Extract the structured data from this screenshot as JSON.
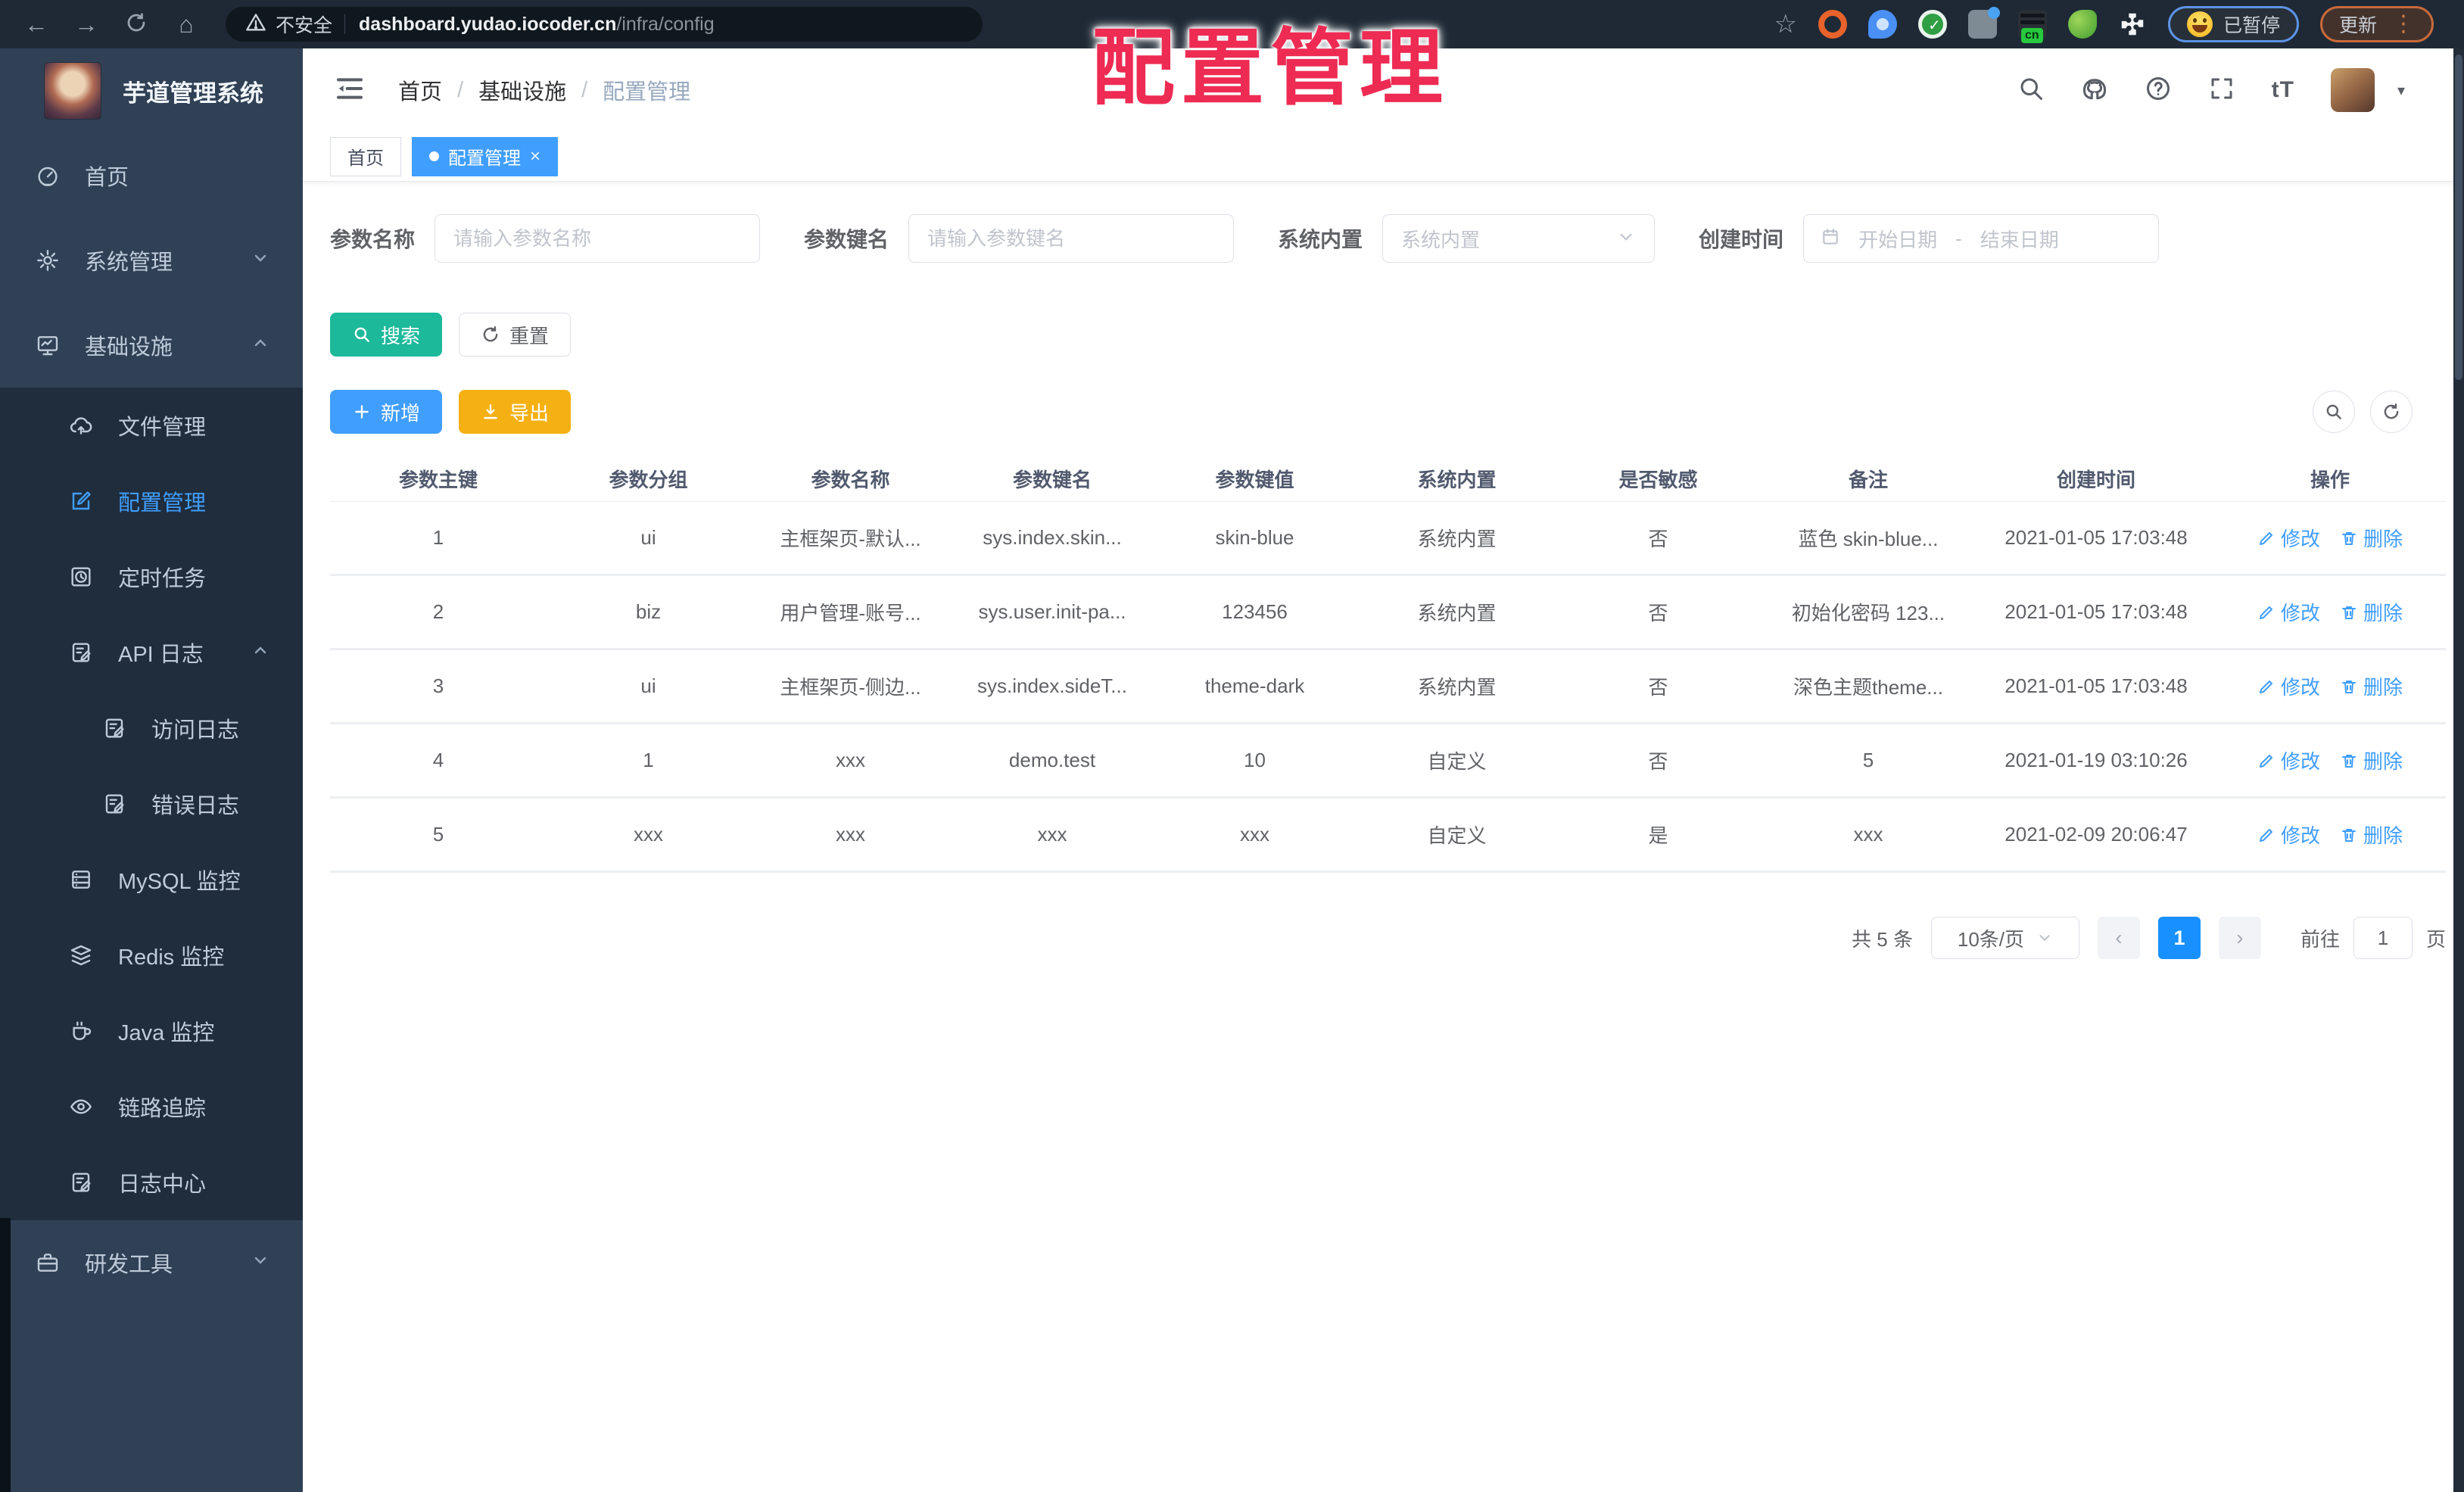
{
  "browser": {
    "security_label": "不安全",
    "url_host": "dashboard.yudao.iocoder.cn",
    "url_path": "/infra/config",
    "paused_label": "已暂停",
    "update_label": "更新",
    "ext_cn_label": "cn",
    "dots_menu": "⋮",
    "back": "←",
    "forward": "→",
    "home": "⌂",
    "star": "☆",
    "caret": "▾"
  },
  "overlay": {
    "title": "配置管理"
  },
  "sidebar": {
    "brand": "芋道管理系统",
    "items": [
      {
        "label": "首页"
      },
      {
        "label": "系统管理"
      },
      {
        "label": "基础设施"
      },
      {
        "label": "文件管理"
      },
      {
        "label": "配置管理"
      },
      {
        "label": "定时任务"
      },
      {
        "label": "API 日志"
      },
      {
        "label": "访问日志"
      },
      {
        "label": "错误日志"
      },
      {
        "label": "MySQL 监控"
      },
      {
        "label": "Redis 监控"
      },
      {
        "label": "Java 监控"
      },
      {
        "label": "链路追踪"
      },
      {
        "label": "日志中心"
      },
      {
        "label": "研发工具"
      }
    ]
  },
  "header": {
    "breadcrumb": [
      "首页",
      "基础设施",
      "配置管理"
    ],
    "separator": "/",
    "font_icon_label": "tT"
  },
  "tabs": [
    {
      "label": "首页"
    },
    {
      "label": "配置管理",
      "close": "×"
    }
  ],
  "filters": {
    "name_label": "参数名称",
    "name_placeholder": "请输入参数名称",
    "key_label": "参数键名",
    "key_placeholder": "请输入参数键名",
    "type_label": "系统内置",
    "type_placeholder": "系统内置",
    "date_label": "创建时间",
    "date_start_placeholder": "开始日期",
    "date_separator": "-",
    "date_end_placeholder": "结束日期",
    "search_label": "搜索",
    "reset_label": "重置"
  },
  "toolbar": {
    "add_label": "新增",
    "export_label": "导出"
  },
  "table": {
    "columns": [
      "参数主键",
      "参数分组",
      "参数名称",
      "参数键名",
      "参数键值",
      "系统内置",
      "是否敏感",
      "备注",
      "创建时间",
      "操作"
    ],
    "edit_label": "修改",
    "delete_label": "删除",
    "rows": [
      [
        "1",
        "ui",
        "主框架页-默认...",
        "sys.index.skin...",
        "skin-blue",
        "系统内置",
        "否",
        "蓝色 skin-blue...",
        "2021-01-05 17:03:48"
      ],
      [
        "2",
        "biz",
        "用户管理-账号...",
        "sys.user.init-pa...",
        "123456",
        "系统内置",
        "否",
        "初始化密码 123...",
        "2021-01-05 17:03:48"
      ],
      [
        "3",
        "ui",
        "主框架页-侧边...",
        "sys.index.sideT...",
        "theme-dark",
        "系统内置",
        "否",
        "深色主题theme...",
        "2021-01-05 17:03:48"
      ],
      [
        "4",
        "1",
        "xxx",
        "demo.test",
        "10",
        "自定义",
        "否",
        "5",
        "2021-01-19 03:10:26"
      ],
      [
        "5",
        "xxx",
        "xxx",
        "xxx",
        "xxx",
        "自定义",
        "是",
        "xxx",
        "2021-02-09 20:06:47"
      ]
    ]
  },
  "pagination": {
    "total": "共 5 条",
    "page_size": "10条/页",
    "current_page": "1",
    "goto_label": "前往",
    "goto_value": "1",
    "page_label": "页"
  },
  "colors": {
    "chrome_bg": "#1e2935",
    "sidebar_bg": "#304156",
    "submenu_bg": "#1f2d3d",
    "menu_active": "#409eff",
    "accent_blue": "#409eff",
    "page_blue": "#1890ff",
    "search_teal": "#1cb99a",
    "export_orange": "#f5b014",
    "overlay_red": "#ee2b53"
  }
}
